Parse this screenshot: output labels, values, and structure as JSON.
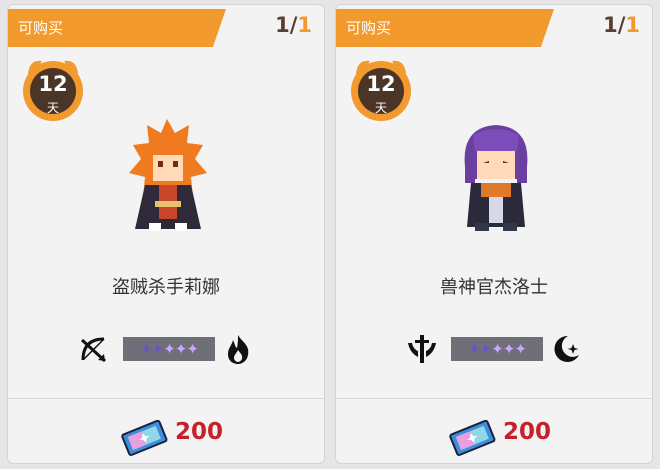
{
  "shop_items": [
    {
      "status_label": "可购买",
      "purchase_count": "1",
      "purchase_limit": "1",
      "timer_value": "12",
      "timer_unit": "天",
      "character_name": "盗贼杀手莉娜",
      "class_icon": "bow-icon",
      "rarity": {
        "dim": "✦✦",
        "lit": "✦✦✦"
      },
      "element_icon": "fire-icon",
      "currency_icon": "ticket-icon",
      "price": "200"
    },
    {
      "status_label": "可购买",
      "purchase_count": "1",
      "purchase_limit": "1",
      "timer_value": "12",
      "timer_unit": "天",
      "character_name": "兽神官杰洛士",
      "class_icon": "priest-icon",
      "rarity": {
        "dim": "✦✦",
        "lit": "✦✦✦"
      },
      "element_icon": "moon-icon",
      "currency_icon": "ticket-icon",
      "price": "200"
    }
  ],
  "colors": {
    "accent": "#f29a2e",
    "price": "#c8202a",
    "timer_bg": "#4b3526",
    "card_bg": "#f3f3f3"
  }
}
